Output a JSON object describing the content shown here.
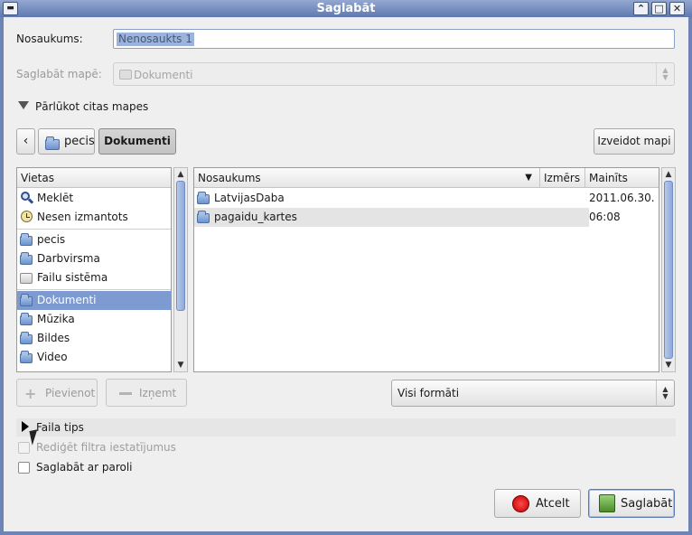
{
  "window": {
    "title": "Saglabāt",
    "buttons": {
      "minimize": "⌃",
      "maximize": "□",
      "close": "✕"
    }
  },
  "name_row": {
    "label": "Nosaukums:",
    "value": "Nenosaukts 1"
  },
  "save_in_row": {
    "label": "Saglabāt mapē:",
    "value": "Dokumenti"
  },
  "browse_toggle": {
    "label": "Pārlūkot citas mapes",
    "expanded": true
  },
  "path_bar": {
    "back_arrow": "‹",
    "crumbs": [
      {
        "label": "pecis",
        "icon": "home-folder-icon"
      },
      {
        "label": "Dokumenti",
        "icon": "",
        "active": true
      }
    ],
    "create_folder_label": "Izveidot mapi"
  },
  "places": {
    "header": "Vietas",
    "groups": [
      [
        {
          "label": "Meklēt",
          "icon": "search-icon"
        },
        {
          "label": "Nesen izmantots",
          "icon": "recent-icon"
        }
      ],
      [
        {
          "label": "pecis",
          "icon": "home-folder-icon"
        },
        {
          "label": "Darbvirsma",
          "icon": "desktop-folder-icon"
        },
        {
          "label": "Failu sistēma",
          "icon": "drive-icon"
        }
      ],
      [
        {
          "label": "Dokumenti",
          "icon": "documents-folder-icon",
          "selected": true
        },
        {
          "label": "Mūzika",
          "icon": "music-folder-icon"
        },
        {
          "label": "Bildes",
          "icon": "pictures-folder-icon"
        },
        {
          "label": "Video",
          "icon": "video-folder-icon"
        }
      ]
    ],
    "add_label": "Pievienot",
    "remove_label": "Izņemt"
  },
  "files": {
    "columns": {
      "name": "Nosaukums",
      "size": "Izmērs",
      "modified": "Mainīts"
    },
    "rows": [
      {
        "name": "LatvijasDaba",
        "size": "",
        "modified": "2011.06.30."
      },
      {
        "name": "pagaidu_kartes",
        "size": "",
        "modified": "06:08"
      }
    ]
  },
  "filter": {
    "selected": "Visi formāti"
  },
  "file_type": {
    "label": "Faila tips"
  },
  "options": {
    "edit_filter_label": "Rediģēt filtra iestatījumus",
    "save_with_password_label": "Saglabāt ar paroli"
  },
  "actions": {
    "cancel_label": "Atcelt",
    "save_label": "Saglabāt"
  },
  "colors": {
    "selection": "#7d9bd0",
    "titlebar": "#6d84b4"
  }
}
